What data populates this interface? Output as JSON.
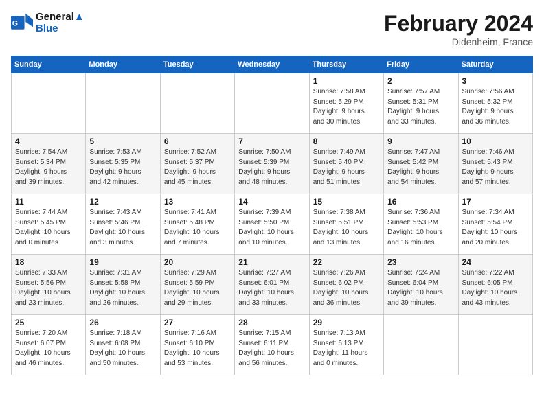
{
  "header": {
    "logo_line1": "General",
    "logo_line2": "Blue",
    "month_title": "February 2024",
    "location": "Didenheim, France"
  },
  "columns": [
    "Sunday",
    "Monday",
    "Tuesday",
    "Wednesday",
    "Thursday",
    "Friday",
    "Saturday"
  ],
  "rows": [
    [
      {
        "day": "",
        "info": ""
      },
      {
        "day": "",
        "info": ""
      },
      {
        "day": "",
        "info": ""
      },
      {
        "day": "",
        "info": ""
      },
      {
        "day": "1",
        "info": "Sunrise: 7:58 AM\nSunset: 5:29 PM\nDaylight: 9 hours\nand 30 minutes."
      },
      {
        "day": "2",
        "info": "Sunrise: 7:57 AM\nSunset: 5:31 PM\nDaylight: 9 hours\nand 33 minutes."
      },
      {
        "day": "3",
        "info": "Sunrise: 7:56 AM\nSunset: 5:32 PM\nDaylight: 9 hours\nand 36 minutes."
      }
    ],
    [
      {
        "day": "4",
        "info": "Sunrise: 7:54 AM\nSunset: 5:34 PM\nDaylight: 9 hours\nand 39 minutes."
      },
      {
        "day": "5",
        "info": "Sunrise: 7:53 AM\nSunset: 5:35 PM\nDaylight: 9 hours\nand 42 minutes."
      },
      {
        "day": "6",
        "info": "Sunrise: 7:52 AM\nSunset: 5:37 PM\nDaylight: 9 hours\nand 45 minutes."
      },
      {
        "day": "7",
        "info": "Sunrise: 7:50 AM\nSunset: 5:39 PM\nDaylight: 9 hours\nand 48 minutes."
      },
      {
        "day": "8",
        "info": "Sunrise: 7:49 AM\nSunset: 5:40 PM\nDaylight: 9 hours\nand 51 minutes."
      },
      {
        "day": "9",
        "info": "Sunrise: 7:47 AM\nSunset: 5:42 PM\nDaylight: 9 hours\nand 54 minutes."
      },
      {
        "day": "10",
        "info": "Sunrise: 7:46 AM\nSunset: 5:43 PM\nDaylight: 9 hours\nand 57 minutes."
      }
    ],
    [
      {
        "day": "11",
        "info": "Sunrise: 7:44 AM\nSunset: 5:45 PM\nDaylight: 10 hours\nand 0 minutes."
      },
      {
        "day": "12",
        "info": "Sunrise: 7:43 AM\nSunset: 5:46 PM\nDaylight: 10 hours\nand 3 minutes."
      },
      {
        "day": "13",
        "info": "Sunrise: 7:41 AM\nSunset: 5:48 PM\nDaylight: 10 hours\nand 7 minutes."
      },
      {
        "day": "14",
        "info": "Sunrise: 7:39 AM\nSunset: 5:50 PM\nDaylight: 10 hours\nand 10 minutes."
      },
      {
        "day": "15",
        "info": "Sunrise: 7:38 AM\nSunset: 5:51 PM\nDaylight: 10 hours\nand 13 minutes."
      },
      {
        "day": "16",
        "info": "Sunrise: 7:36 AM\nSunset: 5:53 PM\nDaylight: 10 hours\nand 16 minutes."
      },
      {
        "day": "17",
        "info": "Sunrise: 7:34 AM\nSunset: 5:54 PM\nDaylight: 10 hours\nand 20 minutes."
      }
    ],
    [
      {
        "day": "18",
        "info": "Sunrise: 7:33 AM\nSunset: 5:56 PM\nDaylight: 10 hours\nand 23 minutes."
      },
      {
        "day": "19",
        "info": "Sunrise: 7:31 AM\nSunset: 5:58 PM\nDaylight: 10 hours\nand 26 minutes."
      },
      {
        "day": "20",
        "info": "Sunrise: 7:29 AM\nSunset: 5:59 PM\nDaylight: 10 hours\nand 29 minutes."
      },
      {
        "day": "21",
        "info": "Sunrise: 7:27 AM\nSunset: 6:01 PM\nDaylight: 10 hours\nand 33 minutes."
      },
      {
        "day": "22",
        "info": "Sunrise: 7:26 AM\nSunset: 6:02 PM\nDaylight: 10 hours\nand 36 minutes."
      },
      {
        "day": "23",
        "info": "Sunrise: 7:24 AM\nSunset: 6:04 PM\nDaylight: 10 hours\nand 39 minutes."
      },
      {
        "day": "24",
        "info": "Sunrise: 7:22 AM\nSunset: 6:05 PM\nDaylight: 10 hours\nand 43 minutes."
      }
    ],
    [
      {
        "day": "25",
        "info": "Sunrise: 7:20 AM\nSunset: 6:07 PM\nDaylight: 10 hours\nand 46 minutes."
      },
      {
        "day": "26",
        "info": "Sunrise: 7:18 AM\nSunset: 6:08 PM\nDaylight: 10 hours\nand 50 minutes."
      },
      {
        "day": "27",
        "info": "Sunrise: 7:16 AM\nSunset: 6:10 PM\nDaylight: 10 hours\nand 53 minutes."
      },
      {
        "day": "28",
        "info": "Sunrise: 7:15 AM\nSunset: 6:11 PM\nDaylight: 10 hours\nand 56 minutes."
      },
      {
        "day": "29",
        "info": "Sunrise: 7:13 AM\nSunset: 6:13 PM\nDaylight: 11 hours\nand 0 minutes."
      },
      {
        "day": "",
        "info": ""
      },
      {
        "day": "",
        "info": ""
      }
    ]
  ]
}
